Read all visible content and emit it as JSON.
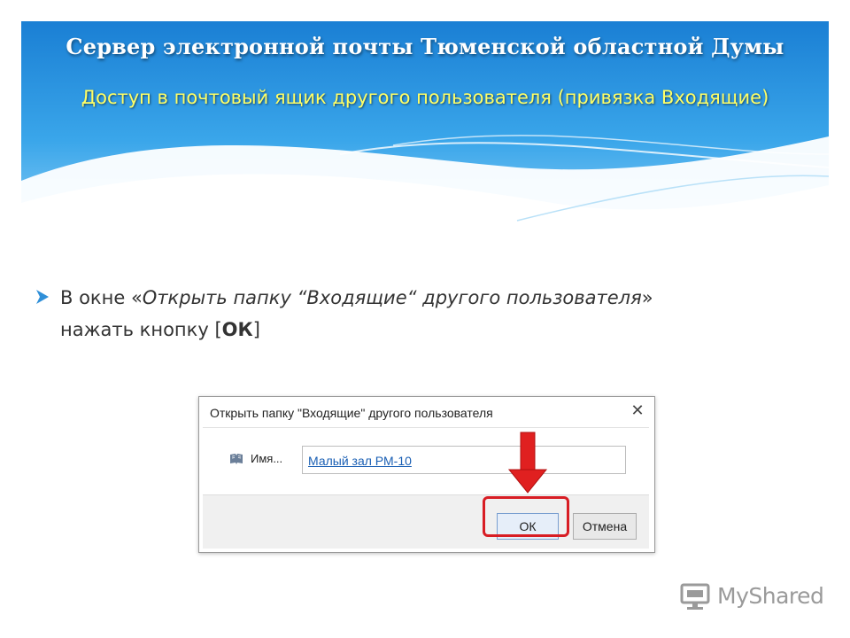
{
  "slide": {
    "title": "Сервер электронной почты Тюменской областной Думы",
    "subtitle": "Доступ в почтовый ящик другого пользователя (привязка Входящие)",
    "bullet": {
      "part1": "В окне «",
      "italic": "Открыть папку “Входящие“ другого пользователя",
      "part2": "»",
      "line2_prefix": "нажать кнопку [",
      "ok": "ОК",
      "line2_suffix": "]"
    }
  },
  "dialog": {
    "title": "Открыть папку \"Входящие\" другого пользователя",
    "close_glyph": "✕",
    "name_label": "Имя...",
    "name_value": "Малый зал РМ-10",
    "ok_label": "ОК",
    "cancel_label": "Отмена",
    "name_icon": "address-book-icon"
  },
  "annotations": {
    "arrow_color": "#e02020",
    "highlight_color": "#d81d24"
  },
  "watermark": {
    "text": "MyShared"
  },
  "colors": {
    "header_blue": "#1e88d8",
    "subtitle_yellow": "#ffff66"
  }
}
